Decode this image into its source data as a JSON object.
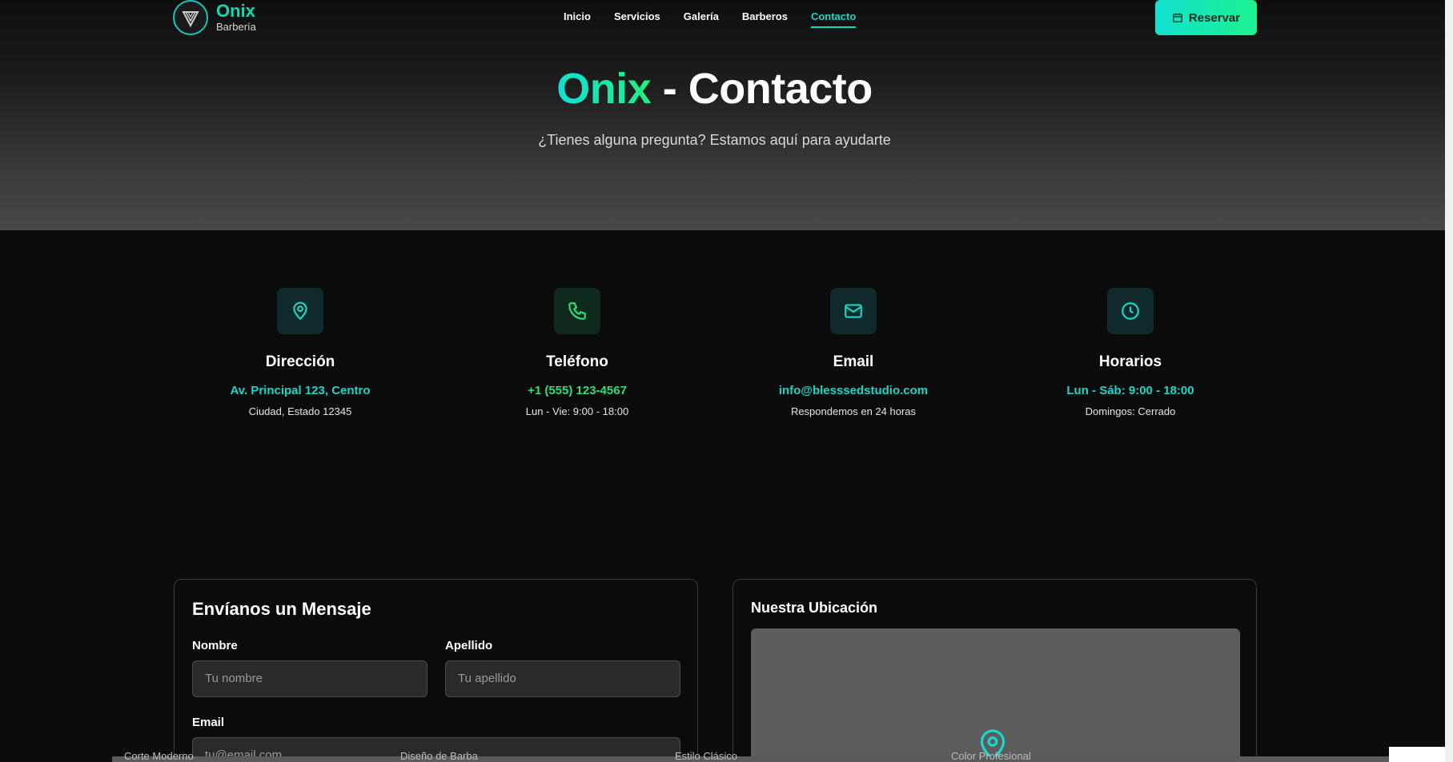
{
  "nav": {
    "brand": "Onix",
    "brand_sub": "Barbería",
    "links": [
      "Inicio",
      "Servicios",
      "Galería",
      "Barberos",
      "Contacto"
    ],
    "active_link": "Contacto",
    "reserve_label": "Reservar"
  },
  "hero": {
    "title_brand": "Onix",
    "title_rest": " - Contacto",
    "subtitle": "¿Tienes alguna pregunta? Estamos aquí para ayudarte"
  },
  "info": [
    {
      "icon": "map-pin-icon",
      "title": "Dirección",
      "main": "Av. Principal 123, Centro",
      "sub": "Ciudad, Estado 12345"
    },
    {
      "icon": "phone-icon",
      "title": "Teléfono",
      "main": "+1 (555) 123-4567",
      "sub": "Lun - Vie: 9:00 - 18:00"
    },
    {
      "icon": "mail-icon",
      "title": "Email",
      "main": "info@blesssedstudio.com",
      "sub": "Respondemos en 24 horas"
    },
    {
      "icon": "clock-icon",
      "title": "Horarios",
      "main": "Lun - Sáb: 9:00 - 18:00",
      "sub": "Domingos: Cerrado"
    }
  ],
  "form": {
    "title": "Envíanos un Mensaje",
    "nombre_label": "Nombre",
    "nombre_placeholder": "Tu nombre",
    "apellido_label": "Apellido",
    "apellido_placeholder": "Tu apellido",
    "email_label": "Email",
    "email_placeholder": "tu@email.com"
  },
  "map": {
    "title": "Nuestra Ubicación"
  },
  "strip": {
    "items": [
      "Corte Moderno",
      "Diseño de Barba",
      "Estilo Clásico",
      "Color Profesional"
    ]
  },
  "colors": {
    "accent_cyan": "#19d6c8",
    "accent_green": "#28e07a"
  }
}
